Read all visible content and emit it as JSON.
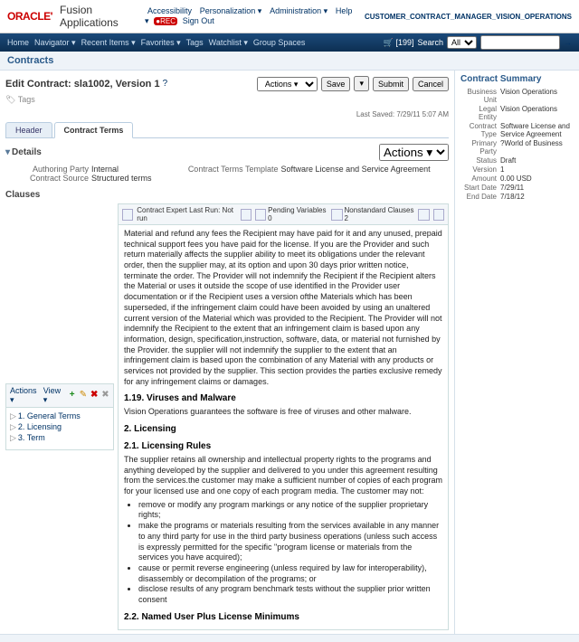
{
  "brand": {
    "oracle": "ORACLE'",
    "app": "Fusion Applications",
    "links": [
      "Accessibility",
      "Personalization ▾",
      "Administration ▾",
      "Help ▾"
    ],
    "rec": "●REC",
    "signout": "Sign Out",
    "user": "CUSTOMER_CONTRACT_MANAGER_VISION_OPERATIONS",
    "cart": "🛒 [199]"
  },
  "nav": {
    "items": [
      "Home",
      "Navigator ▾",
      "Recent Items ▾",
      "Favorites ▾",
      "Tags",
      "Watchlist ▾",
      "Group Spaces"
    ],
    "search_lbl": "Search",
    "search_scope": "All",
    "go": "→"
  },
  "crumb": "Contracts",
  "page": {
    "title": "Edit Contract: sla1002, Version 1",
    "help": "?",
    "tags": "🏷 Tags",
    "actions_menu": "Actions ▾",
    "save": "Save",
    "save_menu": "▾",
    "submit": "Submit",
    "cancel": "Cancel",
    "last_saved": "Last Saved: 7/29/11 5:07 AM"
  },
  "tabs": [
    "Header",
    "Contract Terms"
  ],
  "details": {
    "heading": "Details",
    "actions": "Actions ▾",
    "authoring_party_lbl": "Authoring Party",
    "authoring_party": "Internal",
    "contract_source_lbl": "Contract Source",
    "contract_source": "Structured terms",
    "template_lbl": "Contract Terms Template",
    "template": "Software License and Service Agreement"
  },
  "clauses": {
    "heading": "Clauses",
    "actions": "Actions ▾",
    "view": "View ▾",
    "items": [
      "1. General Terms",
      "2. Licensing",
      "3. Term"
    ]
  },
  "doc_tb": {
    "expert": "Contract Expert Last Run: Not run",
    "pending": "Pending Variables  0",
    "nonstd": "Nonstandard Clauses  2"
  },
  "doc": {
    "intro": "Material and refund any fees the Recipient may have paid for it and any unused, prepaid technical support fees you have paid for the license. If you are the Provider and such return materially affects the supplier ability to meet its obligations under the relevant order, then the supplier may, at its option and upon 30 days prior written notice, terminate the order. The Provider will not indemnify the Recipient if the Recipient alters the Material or uses it outside the scope of use identified in the Provider user documentation or if the Recipient uses a version ofthe Materials which has been superseded, if the infringement claim could have been avoided by using an unaltered current version of the Material which was provided to the Recipient. The Provider will not indemnify the Recipient to the extent that an infringement claim is based upon any information, design, specification,instruction, software, data, or material not furnished by the Provider.  the supplier will not indemnify the supplier to the extent that an infringement claim is based upon the combination of any Material with any products or services not provided by the supplier. This section provides the parties exclusive remedy for any infringement claims or damages.",
    "h119": "1.19. Viruses and Malware",
    "p119": "Vision Operations guarantees the software is free of viruses and other malware.",
    "h2": "2. Licensing",
    "h21": "2.1. Licensing Rules",
    "p21": "The supplier retains all ownership and intellectual property rights to the programs and anything developed by the supplier and delivered to you under this agreement resulting from the services.the customer may make a sufficient number of copies of each program for your licensed use and one copy of each program media. The customer may not:",
    "b1": "remove or modify any program markings or any notice of the supplier proprietary rights;",
    "b2": "make the programs or materials resulting from the services available in any manner to any third party for use in the third party business operations (unless such access is expressly permitted for the specific \"program license or materials from the services you have acquired);",
    "b3": "cause or permit reverse engineering (unless required by law for interoperability), disassembly or decompilation of the programs; or",
    "b4": "disclose results of any program benchmark tests without the supplier prior written consent",
    "h22": "2.2. Named User Plus License Minimums"
  },
  "summary": {
    "title": "Contract Summary",
    "rows": [
      [
        "Business Unit",
        "Vision Operations"
      ],
      [
        "Legal Entity",
        "Vision Operations"
      ],
      [
        "Contract Type",
        "Software License and Service Agreement"
      ],
      [
        "Primary Party",
        "?World of Business"
      ],
      [
        "Status",
        "Draft"
      ],
      [
        "Version",
        "1"
      ],
      [
        "Amount",
        "0.00  USD"
      ],
      [
        "Start Date",
        "7/29/11"
      ],
      [
        "End Date",
        "7/18/12"
      ]
    ]
  }
}
